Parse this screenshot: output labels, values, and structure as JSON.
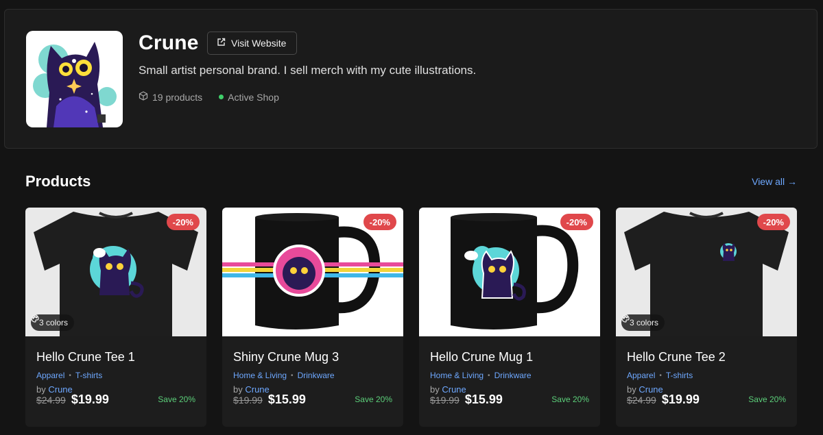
{
  "shop": {
    "name": "Crune",
    "visit_label": "Visit Website",
    "description": "Small artist personal brand. I sell merch with my cute illustrations.",
    "product_count": "19 products",
    "status": "Active Shop",
    "status_color": "#3fcf6a"
  },
  "products_section": {
    "title": "Products",
    "view_all": "View all →"
  },
  "products": [
    {
      "name": "Hello Crune Tee 1",
      "category": "Apparel",
      "subcategory": "T-shirts",
      "by_label": "by",
      "vendor": "Crune",
      "old_price": "$24.99",
      "price": "$19.99",
      "discount": "-20%",
      "save": "Save 20%",
      "colors": "3 colors"
    },
    {
      "name": "Shiny Crune Mug 3",
      "category": "Home & Living",
      "subcategory": "Drinkware",
      "by_label": "by",
      "vendor": "Crune",
      "old_price": "$19.99",
      "price": "$15.99",
      "discount": "-20%",
      "save": "Save 20%"
    },
    {
      "name": "Hello Crune Mug 1",
      "category": "Home & Living",
      "subcategory": "Drinkware",
      "by_label": "by",
      "vendor": "Crune",
      "old_price": "$19.99",
      "price": "$15.99",
      "discount": "-20%",
      "save": "Save 20%"
    },
    {
      "name": "Hello Crune Tee 2",
      "category": "Apparel",
      "subcategory": "T-shirts",
      "by_label": "by",
      "vendor": "Crune",
      "old_price": "$24.99",
      "price": "$19.99",
      "discount": "-20%",
      "save": "Save 20%",
      "colors": "3 colors"
    }
  ],
  "colors": {
    "background": "#141414",
    "card": "#1d1d1d",
    "link": "#6ea8ff",
    "discount_badge": "#e0484b",
    "save_text": "#5ccf7a"
  }
}
